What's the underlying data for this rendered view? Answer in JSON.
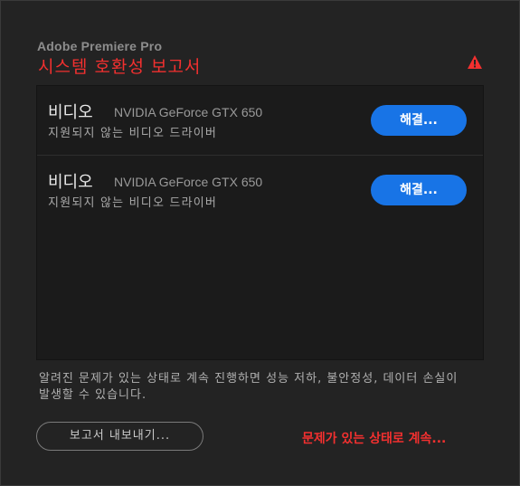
{
  "header": {
    "app_name": "Adobe Premiere Pro",
    "title": "시스템 호환성 보고서",
    "warning_icon": "warning-triangle-icon",
    "accent_color": "#f2302f"
  },
  "issues": [
    {
      "category": "비디오",
      "device": "NVIDIA GeForce GTX 650",
      "description": "지원되지 않는 비디오 드라이버",
      "fix_label": "해결..."
    },
    {
      "category": "비디오",
      "device": "NVIDIA GeForce GTX 650",
      "description": "지원되지 않는 비디오 드라이버",
      "fix_label": "해결..."
    }
  ],
  "footer": {
    "notice": "알려진 문제가 있는 상태로 계속 진행하면 성능 저하, 불안정성, 데이터 손실이 발생할 수 있습니다.",
    "export_label": "보고서 내보내기...",
    "continue_label": "문제가 있는 상태로 계속...",
    "button_color": "#1874e6"
  }
}
